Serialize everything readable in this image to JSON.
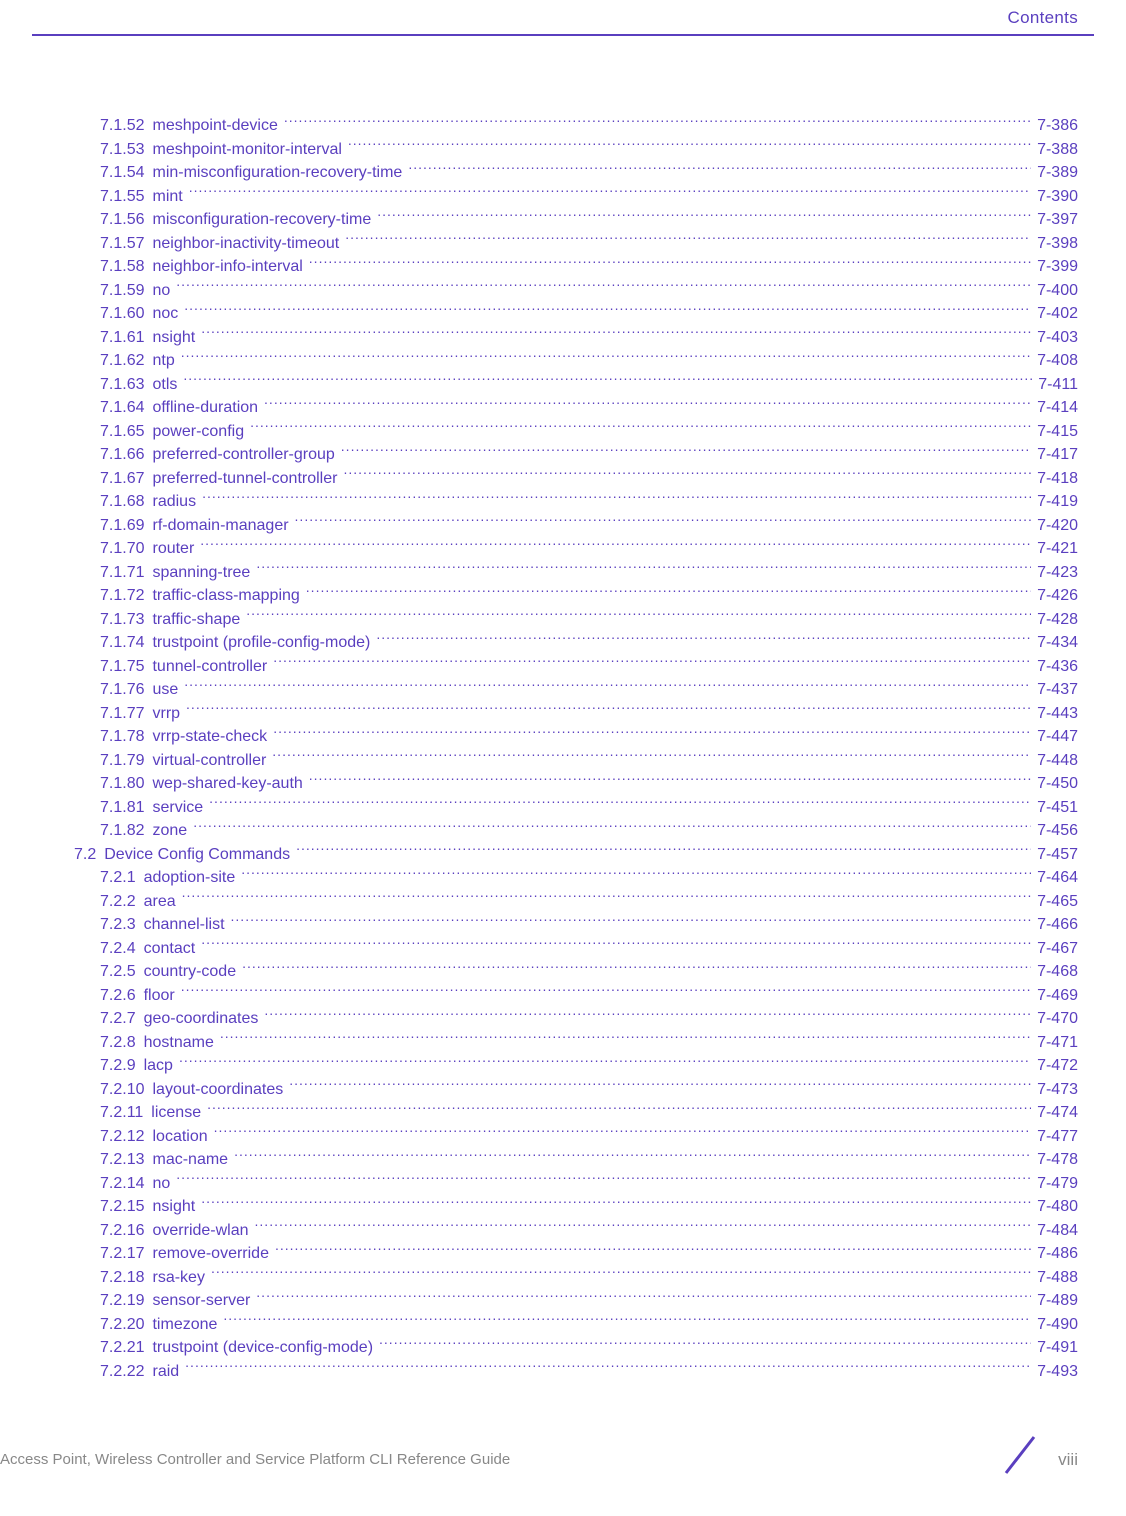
{
  "header": {
    "label": "Contents"
  },
  "footer": {
    "guide": "Access Point, Wireless Controller and Service Platform CLI Reference Guide",
    "pagenum": "viii"
  },
  "colors": {
    "accent": "#5a3fbf",
    "muted": "#888888"
  },
  "toc": [
    {
      "indent": 2,
      "num": "7.1.52",
      "title": "meshpoint-device",
      "page": "7-386"
    },
    {
      "indent": 2,
      "num": "7.1.53",
      "title": "meshpoint-monitor-interval",
      "page": "7-388"
    },
    {
      "indent": 2,
      "num": "7.1.54",
      "title": "min-misconfiguration-recovery-time",
      "page": "7-389"
    },
    {
      "indent": 2,
      "num": "7.1.55",
      "title": "mint",
      "page": "7-390"
    },
    {
      "indent": 2,
      "num": "7.1.56",
      "title": "misconfiguration-recovery-time",
      "page": "7-397"
    },
    {
      "indent": 2,
      "num": "7.1.57",
      "title": "neighbor-inactivity-timeout",
      "page": "7-398"
    },
    {
      "indent": 2,
      "num": "7.1.58",
      "title": "neighbor-info-interval",
      "page": "7-399"
    },
    {
      "indent": 2,
      "num": "7.1.59",
      "title": "no",
      "page": "7-400"
    },
    {
      "indent": 2,
      "num": "7.1.60",
      "title": "noc",
      "page": "7-402"
    },
    {
      "indent": 2,
      "num": "7.1.61",
      "title": "nsight",
      "page": "7-403"
    },
    {
      "indent": 2,
      "num": "7.1.62",
      "title": "ntp",
      "page": "7-408"
    },
    {
      "indent": 2,
      "num": "7.1.63",
      "title": "otls",
      "page": "7-411"
    },
    {
      "indent": 2,
      "num": "7.1.64",
      "title": "offline-duration",
      "page": "7-414"
    },
    {
      "indent": 2,
      "num": "7.1.65",
      "title": "power-config",
      "page": "7-415"
    },
    {
      "indent": 2,
      "num": "7.1.66",
      "title": "preferred-controller-group",
      "page": "7-417"
    },
    {
      "indent": 2,
      "num": "7.1.67",
      "title": "preferred-tunnel-controller",
      "page": "7-418"
    },
    {
      "indent": 2,
      "num": "7.1.68",
      "title": "radius",
      "page": "7-419"
    },
    {
      "indent": 2,
      "num": "7.1.69",
      "title": "rf-domain-manager",
      "page": "7-420"
    },
    {
      "indent": 2,
      "num": "7.1.70",
      "title": "router",
      "page": "7-421"
    },
    {
      "indent": 2,
      "num": "7.1.71",
      "title": "spanning-tree",
      "page": "7-423"
    },
    {
      "indent": 2,
      "num": "7.1.72",
      "title": "traffic-class-mapping",
      "page": "7-426"
    },
    {
      "indent": 2,
      "num": "7.1.73",
      "title": "traffic-shape",
      "page": "7-428"
    },
    {
      "indent": 2,
      "num": "7.1.74",
      "title": "trustpoint (profile-config-mode)",
      "page": "7-434"
    },
    {
      "indent": 2,
      "num": "7.1.75",
      "title": "tunnel-controller",
      "page": "7-436"
    },
    {
      "indent": 2,
      "num": "7.1.76",
      "title": "use",
      "page": "7-437"
    },
    {
      "indent": 2,
      "num": "7.1.77",
      "title": "vrrp",
      "page": "7-443"
    },
    {
      "indent": 2,
      "num": "7.1.78",
      "title": "vrrp-state-check",
      "page": "7-447"
    },
    {
      "indent": 2,
      "num": "7.1.79",
      "title": "virtual-controller",
      "page": "7-448"
    },
    {
      "indent": 2,
      "num": "7.1.80",
      "title": "wep-shared-key-auth",
      "page": "7-450"
    },
    {
      "indent": 2,
      "num": "7.1.81",
      "title": "service",
      "page": "7-451"
    },
    {
      "indent": 2,
      "num": "7.1.82",
      "title": "zone",
      "page": "7-456"
    },
    {
      "indent": 1,
      "num": "7.2",
      "title": "Device Config Commands",
      "page": "7-457"
    },
    {
      "indent": 2,
      "num": "7.2.1",
      "title": "adoption-site",
      "page": "7-464"
    },
    {
      "indent": 2,
      "num": "7.2.2",
      "title": "area",
      "page": "7-465"
    },
    {
      "indent": 2,
      "num": "7.2.3",
      "title": "channel-list",
      "page": "7-466"
    },
    {
      "indent": 2,
      "num": "7.2.4",
      "title": "contact",
      "page": "7-467"
    },
    {
      "indent": 2,
      "num": "7.2.5",
      "title": "country-code",
      "page": "7-468"
    },
    {
      "indent": 2,
      "num": "7.2.6",
      "title": "floor",
      "page": "7-469"
    },
    {
      "indent": 2,
      "num": "7.2.7",
      "title": "geo-coordinates",
      "page": "7-470"
    },
    {
      "indent": 2,
      "num": "7.2.8",
      "title": "hostname",
      "page": "7-471"
    },
    {
      "indent": 2,
      "num": "7.2.9",
      "title": "lacp",
      "page": "7-472"
    },
    {
      "indent": 2,
      "num": "7.2.10",
      "title": "layout-coordinates",
      "page": "7-473"
    },
    {
      "indent": 2,
      "num": "7.2.11",
      "title": "license",
      "page": "7-474"
    },
    {
      "indent": 2,
      "num": "7.2.12",
      "title": "location",
      "page": "7-477"
    },
    {
      "indent": 2,
      "num": "7.2.13",
      "title": "mac-name",
      "page": "7-478"
    },
    {
      "indent": 2,
      "num": "7.2.14",
      "title": "no",
      "page": "7-479"
    },
    {
      "indent": 2,
      "num": "7.2.15",
      "title": "nsight",
      "page": "7-480"
    },
    {
      "indent": 2,
      "num": "7.2.16",
      "title": "override-wlan",
      "page": "7-484"
    },
    {
      "indent": 2,
      "num": "7.2.17",
      "title": "remove-override",
      "page": "7-486"
    },
    {
      "indent": 2,
      "num": "7.2.18",
      "title": "rsa-key",
      "page": "7-488"
    },
    {
      "indent": 2,
      "num": "7.2.19",
      "title": "sensor-server",
      "page": "7-489"
    },
    {
      "indent": 2,
      "num": "7.2.20",
      "title": "timezone",
      "page": "7-490"
    },
    {
      "indent": 2,
      "num": "7.2.21",
      "title": "trustpoint (device-config-mode)",
      "page": "7-491"
    },
    {
      "indent": 2,
      "num": "7.2.22",
      "title": "raid",
      "page": "7-493"
    }
  ]
}
